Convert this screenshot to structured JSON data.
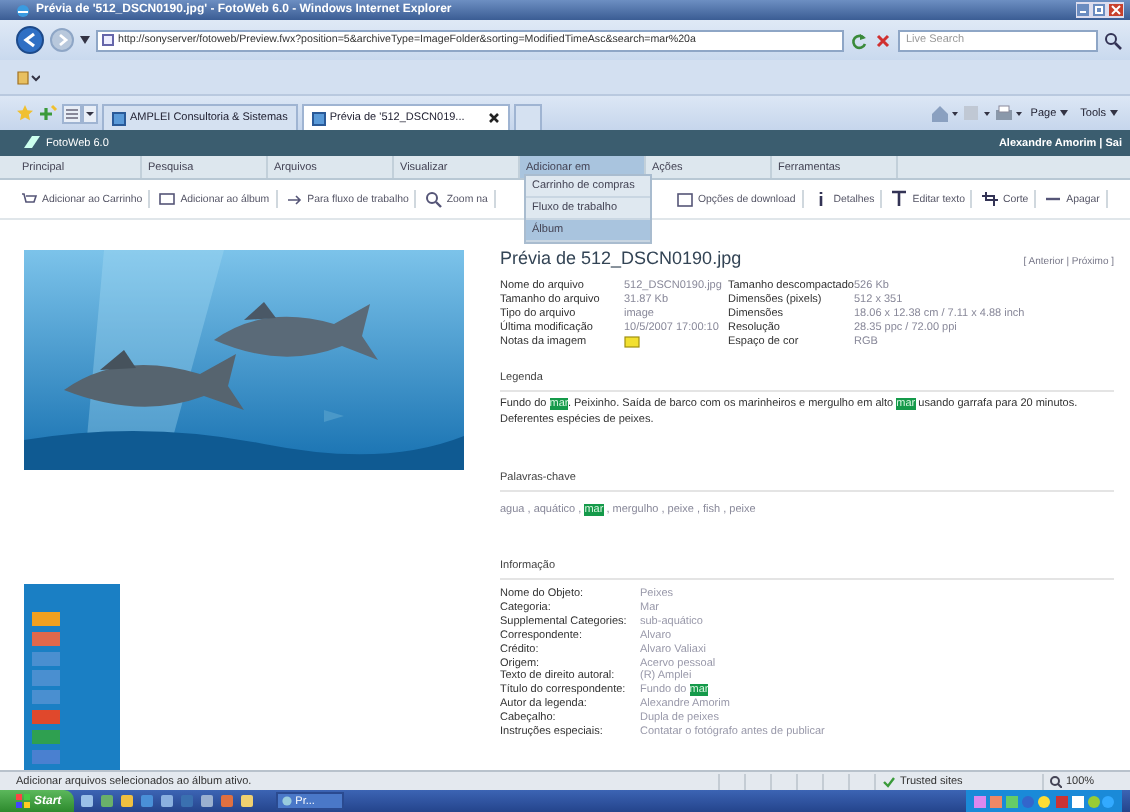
{
  "window": {
    "title": "Prévia de '512_DSCN0190.jpg' - FotoWeb 6.0 - Windows Internet Explorer"
  },
  "address_bar": {
    "url": "http://sonyserver/fotoweb/Preview.fwx?position=5&archiveType=ImageFolder&sorting=ModifiedTimeAsc&search=mar%20a",
    "search_placeholder": "Live Search"
  },
  "browser_tabs": [
    {
      "label": "AMPLEI Consultoria & Sistemas",
      "selected": false
    },
    {
      "label": "Prévia de '512_DSCN019...",
      "selected": true
    }
  ],
  "command_bar": [
    "Page",
    "Tools"
  ],
  "app": {
    "name": "FotoWeb 6.0",
    "user": "Alexandre Amorim | Sai"
  },
  "menu": [
    {
      "label": "Principal",
      "selected": false
    },
    {
      "label": "Pesquisa",
      "selected": false
    },
    {
      "label": "Arquivos",
      "selected": false
    },
    {
      "label": "Visualizar",
      "selected": false
    },
    {
      "label": "Adicionar em",
      "selected": true
    },
    {
      "label": "Ações",
      "selected": false
    },
    {
      "label": "Ferramentas",
      "selected": false
    }
  ],
  "toolbar_left": [
    "Adicionar ao Carrinho",
    "Adicionar ao álbum",
    "Para fluxo de trabalho",
    "Zoom na"
  ],
  "toolbar_right": [
    "Opções de download",
    "Detalhes",
    "Editar texto",
    "Corte",
    "Apagar"
  ],
  "dropdown": [
    {
      "label": "Carrinho de compras",
      "selected": false
    },
    {
      "label": "Fluxo de trabalho",
      "selected": false
    },
    {
      "label": "Álbum",
      "selected": true
    }
  ],
  "preview": {
    "title": "Prévia de 512_DSCN0190.jpg",
    "nav": "[ Anterior | Próximo ]",
    "file_info": [
      {
        "kind": "text",
        "label": "Nome do arquivo",
        "value": "512_DSCN0190.jpg",
        "label_2": "Tamanho descompactado",
        "value_2": "526 Kb"
      },
      {
        "kind": "text",
        "label": "Tamanho do arquivo",
        "value": "31.87 Kb",
        "label_2": "Dimensões (pixels)",
        "value_2": "512 x 351"
      },
      {
        "kind": "text",
        "label": "Tipo do arquivo",
        "value": "image",
        "label_2": "Dimensões",
        "value_2": "18.06 x 12.38 cm / 7.11 x 4.88 inch"
      },
      {
        "kind": "text",
        "label": "Última modificação",
        "value": "10/5/2007 17:00:10",
        "label_2": "Resolução",
        "value_2": "28.35 ppc / 72.00 ppi"
      },
      {
        "kind": "note",
        "label": "Notas da imagem",
        "label_2": "Espaço de cor",
        "value_2": "RGB"
      }
    ],
    "caption_heading": "Legenda",
    "caption": [
      {
        "text": "Fundo do ",
        "highlight": false
      },
      {
        "text": "mar",
        "highlight": true
      },
      {
        "text": ". Peixinho. Saída de barco com os marinheiros e mergulho em alto ",
        "highlight": false
      },
      {
        "text": "mar",
        "highlight": true
      },
      {
        "text": " usando garrafa para 20 minutos. Deferentes espécies de peixes.",
        "highlight": false
      }
    ],
    "keywords_heading": "Palavras-chave",
    "keywords": [
      {
        "text": "agua , aquático , ",
        "highlight": false
      },
      {
        "text": "mar",
        "highlight": true
      },
      {
        "text": " , mergulho , peixe , fish , peixe",
        "highlight": false
      }
    ],
    "info_heading": "Informação",
    "info": [
      {
        "label": "Nome do Objeto:",
        "value": [
          {
            "text": "Peixes",
            "highlight": false
          }
        ]
      },
      {
        "label": "Categoria:",
        "value": [
          {
            "text": "Mar",
            "highlight": false
          }
        ]
      },
      {
        "label": "Supplemental Categories:",
        "value": [
          {
            "text": "sub-aquático",
            "highlight": false
          }
        ]
      },
      {
        "label": "Correspondente:",
        "value": [
          {
            "text": "Alvaro",
            "highlight": false
          }
        ]
      },
      {
        "label": "Crédito:",
        "value": [
          {
            "text": "Alvaro Valiaxi",
            "highlight": false
          }
        ]
      },
      {
        "label": "Origem:",
        "value": [
          {
            "text": "Acervo pessoal",
            "highlight": false
          }
        ]
      },
      {
        "label": "Texto de direito autoral:",
        "value": [
          {
            "text": "(R) Amplei",
            "highlight": false
          }
        ]
      },
      {
        "label": "Título do correspondente:",
        "value": [
          {
            "text": "Fundo do ",
            "highlight": false
          },
          {
            "text": "mar",
            "highlight": true
          }
        ]
      },
      {
        "label": "Autor da legenda:",
        "value": [
          {
            "text": "Alexandre Amorim",
            "highlight": false
          }
        ]
      },
      {
        "label": "Cabeçalho:",
        "value": [
          {
            "text": "Dupla de peixes",
            "highlight": false
          }
        ]
      },
      {
        "label": "Instruções especiais:",
        "value": [
          {
            "text": "Contatar o fotógrafo antes de publicar",
            "highlight": false
          }
        ]
      }
    ]
  },
  "labels": [
    {
      "color": "#f0a020"
    },
    {
      "color": "#e0684c"
    },
    {
      "color": "#4a8fd0"
    },
    {
      "color": "#4a8fd0"
    },
    {
      "color": "#4a8fd0"
    },
    {
      "color": "#e0482c"
    },
    {
      "color": "#2fa050"
    },
    {
      "color": "#4a80d0"
    }
  ],
  "status_bar": {
    "text": "Adicionar arquivos selecionados ao álbum ativo.",
    "zone": "Trusted sites",
    "zoom": "100%"
  },
  "taskbar": {
    "start": "Start",
    "task": "Pr..."
  }
}
